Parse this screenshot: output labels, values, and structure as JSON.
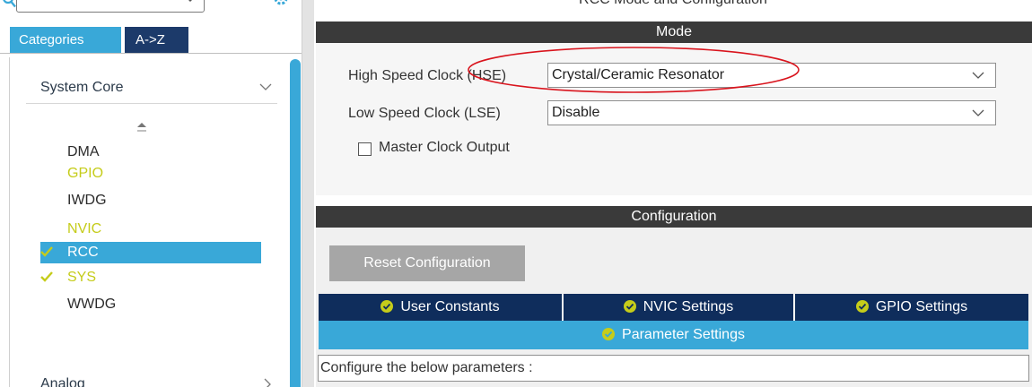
{
  "colors": {
    "accent_blue": "#39a8d8",
    "navy": "#1c3a6a",
    "section_bar": "#3a3a3a",
    "configured_text": "#c5cc1a",
    "checkmark": "#c5cc1a",
    "highlight_oval": "#d9141d"
  },
  "left_panel": {
    "icons": {
      "search": "search-icon",
      "gear": "gear-icon"
    },
    "tabs": [
      {
        "label": "Categories",
        "active": true
      },
      {
        "label": "A->Z",
        "active": false
      }
    ],
    "groups": [
      {
        "label": "System Core",
        "expanded": true
      },
      {
        "label": "Analog",
        "expanded": false
      }
    ],
    "peripherals": [
      {
        "label": "DMA",
        "configured": false,
        "checked": false,
        "selected": false
      },
      {
        "label": "GPIO",
        "configured": true,
        "checked": false,
        "selected": false
      },
      {
        "label": "IWDG",
        "configured": false,
        "checked": false,
        "selected": false
      },
      {
        "label": "NVIC",
        "configured": true,
        "checked": false,
        "selected": false
      },
      {
        "label": "RCC",
        "configured": true,
        "checked": true,
        "selected": true
      },
      {
        "label": "SYS",
        "configured": true,
        "checked": true,
        "selected": false
      },
      {
        "label": "WWDG",
        "configured": false,
        "checked": false,
        "selected": false
      }
    ]
  },
  "right_panel": {
    "title": "RCC Mode and Configuration",
    "mode": {
      "header": "Mode",
      "hse": {
        "label": "High Speed Clock (HSE)",
        "value": "Crystal/Ceramic Resonator",
        "highlighted": true
      },
      "lse": {
        "label": "Low Speed Clock (LSE)",
        "value": "Disable"
      },
      "mco": {
        "label": "Master Clock Output",
        "checked": false
      }
    },
    "configuration": {
      "header": "Configuration",
      "reset_label": "Reset Configuration",
      "tabs": [
        {
          "label": "User Constants"
        },
        {
          "label": "NVIC Settings"
        },
        {
          "label": "GPIO Settings"
        }
      ],
      "active_tab": {
        "label": "Parameter Settings"
      },
      "hint": "Configure the below parameters :"
    }
  }
}
